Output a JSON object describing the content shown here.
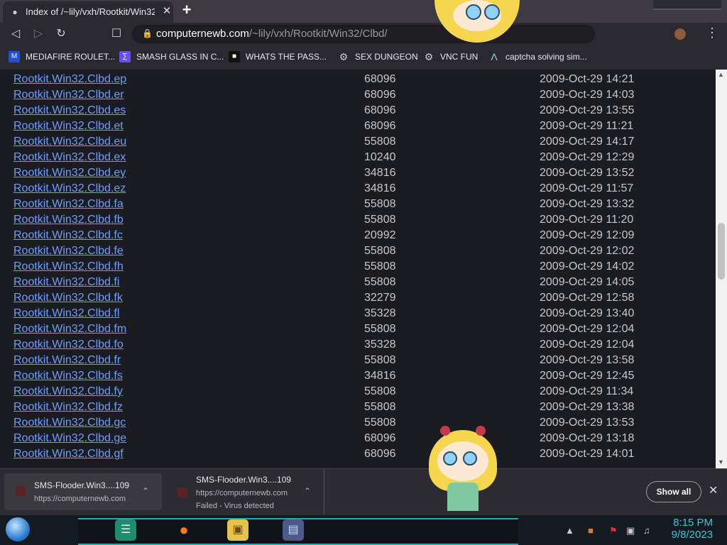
{
  "browser": {
    "tab_title": "Index of /~lily/vxh/Rootkit/Win32/",
    "url_host": "computernewb.com",
    "url_path": "/~lily/vxh/Rootkit/Win32/Clbd/"
  },
  "bookmarks": [
    {
      "label": "MEDIAFIRE ROULET...",
      "icon": "mediafire-icon",
      "color": "#1f4fd8"
    },
    {
      "label": "SMASH GLASS IN C...",
      "icon": "glass-icon",
      "color": "#6a4cf0"
    },
    {
      "label": "WHATS THE PASS...",
      "icon": "question-icon",
      "color": "#222222"
    },
    {
      "label": "SEX DUNGEON",
      "icon": "gear-icon",
      "color": "#888888"
    },
    {
      "label": "VNC FUN",
      "icon": "gear-icon",
      "color": "#888888"
    },
    {
      "label": "captcha solving sim...",
      "icon": "a-logo-icon",
      "color": "#2b2930"
    }
  ],
  "listing": [
    {
      "name": "Rootkit.Win32.Clbd.ep",
      "size": "68096",
      "date": "2009-Oct-29 14:21"
    },
    {
      "name": "Rootkit.Win32.Clbd.er",
      "size": "68096",
      "date": "2009-Oct-29 14:03"
    },
    {
      "name": "Rootkit.Win32.Clbd.es",
      "size": "68096",
      "date": "2009-Oct-29 13:55"
    },
    {
      "name": "Rootkit.Win32.Clbd.et",
      "size": "68096",
      "date": "2009-Oct-29 11:21"
    },
    {
      "name": "Rootkit.Win32.Clbd.eu",
      "size": "55808",
      "date": "2009-Oct-29 14:17"
    },
    {
      "name": "Rootkit.Win32.Clbd.ex",
      "size": "10240",
      "date": "2009-Oct-29 12:29"
    },
    {
      "name": "Rootkit.Win32.Clbd.ey",
      "size": "34816",
      "date": "2009-Oct-29 13:52"
    },
    {
      "name": "Rootkit.Win32.Clbd.ez",
      "size": "34816",
      "date": "2009-Oct-29 11:57"
    },
    {
      "name": "Rootkit.Win32.Clbd.fa",
      "size": "55808",
      "date": "2009-Oct-29 13:32"
    },
    {
      "name": "Rootkit.Win32.Clbd.fb",
      "size": "55808",
      "date": "2009-Oct-29 11:20"
    },
    {
      "name": "Rootkit.Win32.Clbd.fc",
      "size": "20992",
      "date": "2009-Oct-29 12:09"
    },
    {
      "name": "Rootkit.Win32.Clbd.fe",
      "size": "55808",
      "date": "2009-Oct-29 12:02"
    },
    {
      "name": "Rootkit.Win32.Clbd.fh",
      "size": "55808",
      "date": "2009-Oct-29 14:02"
    },
    {
      "name": "Rootkit.Win32.Clbd.fi",
      "size": "55808",
      "date": "2009-Oct-29 14:05"
    },
    {
      "name": "Rootkit.Win32.Clbd.fk",
      "size": "32279",
      "date": "2009-Oct-29 12:58"
    },
    {
      "name": "Rootkit.Win32.Clbd.fl",
      "size": "35328",
      "date": "2009-Oct-29 13:40"
    },
    {
      "name": "Rootkit.Win32.Clbd.fm",
      "size": "55808",
      "date": "2009-Oct-29 12:04"
    },
    {
      "name": "Rootkit.Win32.Clbd.fo",
      "size": "35328",
      "date": "2009-Oct-29 12:04"
    },
    {
      "name": "Rootkit.Win32.Clbd.fr",
      "size": "55808",
      "date": "2009-Oct-29 13:58"
    },
    {
      "name": "Rootkit.Win32.Clbd.fs",
      "size": "34816",
      "date": "2009-Oct-29 12:45"
    },
    {
      "name": "Rootkit.Win32.Clbd.fy",
      "size": "55808",
      "date": "2009-Oct-29 11:34"
    },
    {
      "name": "Rootkit.Win32.Clbd.fz",
      "size": "55808",
      "date": "2009-Oct-29 13:38"
    },
    {
      "name": "Rootkit.Win32.Clbd.gc",
      "size": "55808",
      "date": "2009-Oct-29 13:53"
    },
    {
      "name": "Rootkit.Win32.Clbd.ge",
      "size": "68096",
      "date": "2009-Oct-29 13:18"
    },
    {
      "name": "Rootkit.Win32.Clbd.gf",
      "size": "68096",
      "date": "2009-Oct-29 14:01"
    }
  ],
  "downloads": {
    "item1": {
      "name": "SMS-Flooder.Win3....109",
      "source": "https://computernewb.com"
    },
    "item2": {
      "name": "SMS-Flooder.Win3....109",
      "source": "https://computernewb.com",
      "status": "Failed - Virus detected"
    },
    "show_all": "Show all"
  },
  "taskbar": {
    "time": "8:15 PM",
    "date": "9/8/2023"
  },
  "colors": {
    "accent": "#2aa6b8",
    "link": "#6f9df7"
  }
}
